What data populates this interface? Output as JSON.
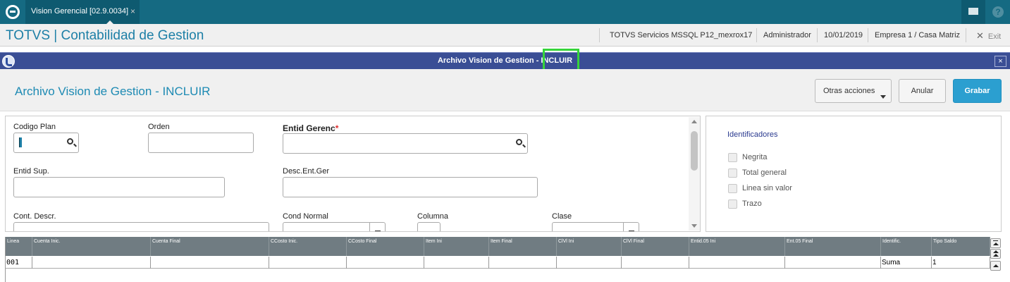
{
  "topbar": {
    "tab_label": "Vision Gerencial [02.9.0034]",
    "tab_close": "×",
    "help_label": "?"
  },
  "header": {
    "app_title": "TOTVS | Contabilidad de Gestion",
    "server": "TOTVS Servicios MSSQL P12_mexrox17",
    "user": "Administrador",
    "date": "10/01/2019",
    "company": "Empresa 1 / Casa Matriz",
    "exit_label": "Exit"
  },
  "dialog": {
    "title": "Archivo Vision de Gestion - INCLUIR",
    "close": "×",
    "heading": "Archivo Vision de Gestion - INCLUIR",
    "buttons": {
      "otras": "Otras acciones",
      "anular": "Anular",
      "grabar": "Grabar"
    }
  },
  "form": {
    "codigo_plan": "Codigo Plan",
    "orden": "Orden",
    "entid_gerenc": "Entid Gerenc",
    "required_mark": "*",
    "entid_sup": "Entid Sup.",
    "desc_ent_ger": "Desc.Ent.Ger",
    "cont_descr": "Cont. Descr.",
    "cond_normal": "Cond Normal",
    "columna": "Columna",
    "clase": "Clase"
  },
  "identificadores": {
    "title": "Identificadores",
    "items": [
      "Negrita",
      "Total general",
      "Linea sin valor",
      "Trazo"
    ]
  },
  "grid": {
    "columns": [
      "Linea",
      "Cuenta Inic.",
      "Cuenta Final",
      "CCosto Inic.",
      "CCosto Final",
      "Item Ini",
      "Item Final",
      "ClVl Ini",
      "ClVl Final",
      "Entid.05 Ini",
      "Ent.05 Final",
      "Identific.",
      "Tipo Saldo"
    ],
    "rows": [
      [
        "001",
        "",
        "",
        "",
        "",
        "",
        "",
        "",
        "",
        "",
        "",
        "Suma",
        "1"
      ]
    ]
  }
}
